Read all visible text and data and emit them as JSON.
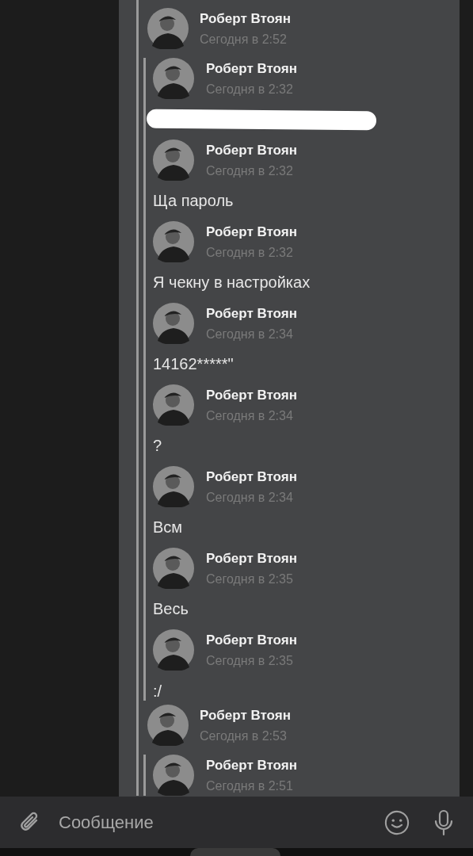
{
  "thread": [
    {
      "author": "Роберт Втоян",
      "time": "Сегодня в 2:52",
      "children": [
        {
          "author": "Роберт Втоян",
          "time": "Сегодня в 2:32",
          "kind": "redacted"
        },
        {
          "author": "Роберт Втоян",
          "time": "Сегодня в 2:32",
          "kind": "text",
          "text": "Ща пароль"
        },
        {
          "author": "Роберт Втоян",
          "time": "Сегодня в 2:32",
          "kind": "text",
          "text": "Я чекну в настройках"
        },
        {
          "author": "Роберт Втоян",
          "time": "Сегодня в 2:34",
          "kind": "text",
          "text": "14162*****\""
        },
        {
          "author": "Роберт Втоян",
          "time": "Сегодня в 2:34",
          "kind": "text",
          "text": "?"
        },
        {
          "author": "Роберт Втоян",
          "time": "Сегодня в 2:34",
          "kind": "text",
          "text": "Всм"
        },
        {
          "author": "Роберт Втоян",
          "time": "Сегодня в 2:35",
          "kind": "text",
          "text": "Весь"
        },
        {
          "author": "Роберт Втоян",
          "time": "Сегодня в 2:35",
          "kind": "text",
          "text": ":/"
        }
      ]
    },
    {
      "author": "Роберт Втоян",
      "time": "Сегодня в 2:53",
      "children": [
        {
          "author": "Роберт Втоян",
          "time": "Сегодня в 2:51"
        }
      ]
    }
  ],
  "composer": {
    "placeholder": "Сообщение"
  }
}
